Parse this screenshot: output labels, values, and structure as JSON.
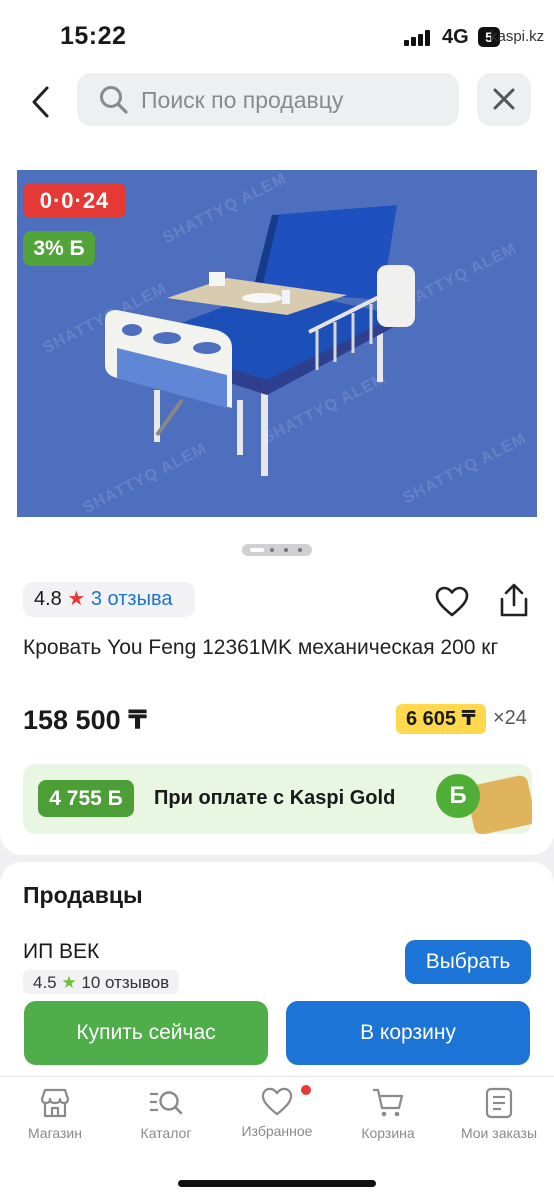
{
  "status_bar": {
    "time": "15:22",
    "network": "4G",
    "carrier_domain": "kaspi.kz",
    "battery_label": "5"
  },
  "search": {
    "placeholder": "Поиск по продавцу",
    "value": ""
  },
  "product": {
    "badge_timer": "0·0·24",
    "badge_bonus": "3% Б",
    "watermark": "SHATTYQ ALEM",
    "rating": "4.8",
    "reviews": "3 отзыва",
    "title": "Кровать You Feng 12361MK механическая 200 кг",
    "price": "158 500 ₸",
    "installment": "6 605 ₸",
    "months": "×24",
    "gallery_count": 4,
    "gallery_active": 0
  },
  "gold": {
    "amount": "4 755 Б",
    "text": "При оплате с Kaspi Gold",
    "coin": "Б"
  },
  "sellers": {
    "title": "Продавцы",
    "seller_name": "ИП ВЕК",
    "seller_rating": "4.5",
    "seller_reviews": "10 отзывов",
    "choose_label": "Выбрать"
  },
  "actions": {
    "buy_now": "Купить сейчас",
    "add_to_cart": "В корзину"
  },
  "nav": {
    "store": "Магазин",
    "catalog": "Каталог",
    "favorites": "Избранное",
    "cart": "Корзина",
    "orders": "Мои заказы"
  },
  "colors": {
    "kaspi_blue": "#1b74d6",
    "kaspi_red": "#e53935",
    "green": "#4fad4a",
    "yellow": "#ffd84d"
  }
}
